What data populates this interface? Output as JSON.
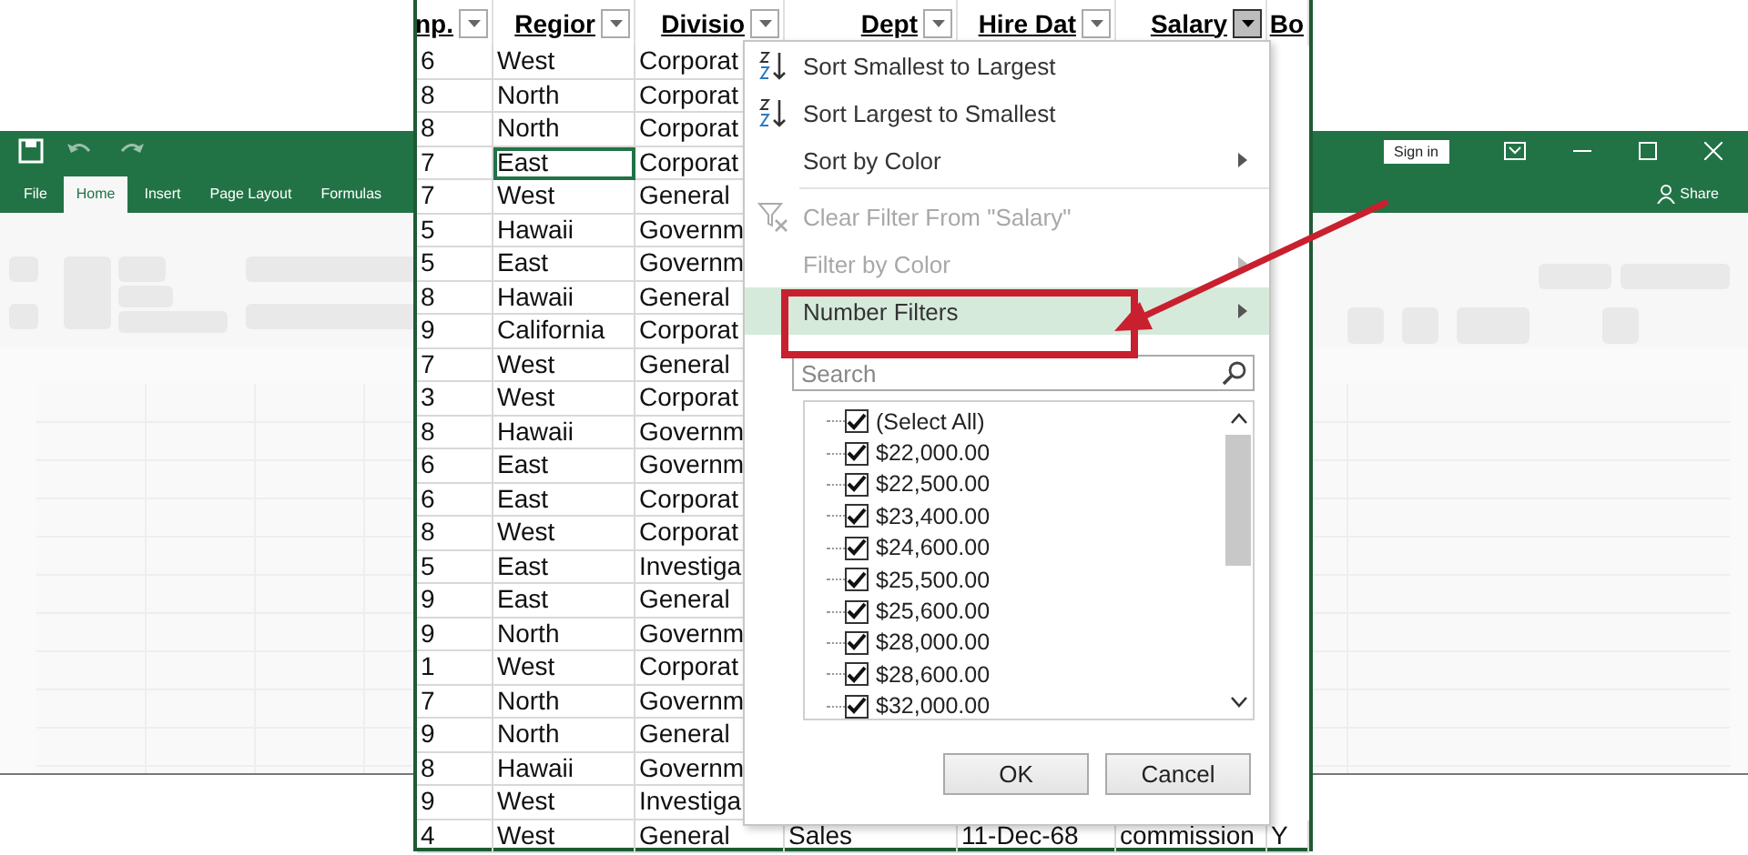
{
  "excel_window": {
    "tabs": [
      {
        "label": "File",
        "selected": false
      },
      {
        "label": "Home",
        "selected": true
      },
      {
        "label": "Insert",
        "selected": false
      },
      {
        "label": "Page Layout",
        "selected": false
      },
      {
        "label": "Formulas",
        "selected": false
      }
    ],
    "sign_in": "Sign in",
    "share": "Share"
  },
  "sheet": {
    "columns": [
      {
        "label": "np.",
        "menu_open": false
      },
      {
        "label": "Regior",
        "menu_open": false
      },
      {
        "label": "Divisio",
        "menu_open": false
      },
      {
        "label": "Dept",
        "menu_open": false
      },
      {
        "label": "Hire Dat",
        "menu_open": false
      },
      {
        "label": "Salary",
        "menu_open": true
      },
      {
        "label": "Bo"
      }
    ],
    "rows": [
      {
        "cells": [
          {
            "text": "6",
            "selected": false
          },
          {
            "text": "West",
            "selected": false
          },
          {
            "text": "Corporat",
            "selected": false
          }
        ]
      },
      {
        "cells": [
          {
            "text": "8",
            "selected": false
          },
          {
            "text": "North",
            "selected": false
          },
          {
            "text": "Corporat",
            "selected": false
          }
        ]
      },
      {
        "cells": [
          {
            "text": "8",
            "selected": false
          },
          {
            "text": "North",
            "selected": false
          },
          {
            "text": "Corporat",
            "selected": false
          }
        ]
      },
      {
        "cells": [
          {
            "text": "7",
            "selected": false
          },
          {
            "text": "East",
            "selected": true
          },
          {
            "text": "Corporat",
            "selected": false
          }
        ]
      },
      {
        "cells": [
          {
            "text": "7",
            "selected": false
          },
          {
            "text": "West",
            "selected": false
          },
          {
            "text": "General",
            "selected": false
          }
        ]
      },
      {
        "cells": [
          {
            "text": "5",
            "selected": false
          },
          {
            "text": "Hawaii",
            "selected": false
          },
          {
            "text": "Governm",
            "selected": false
          }
        ]
      },
      {
        "cells": [
          {
            "text": "5",
            "selected": false
          },
          {
            "text": "East",
            "selected": false
          },
          {
            "text": "Governm",
            "selected": false
          }
        ]
      },
      {
        "cells": [
          {
            "text": "8",
            "selected": false
          },
          {
            "text": "Hawaii",
            "selected": false
          },
          {
            "text": "General",
            "selected": false
          }
        ]
      },
      {
        "cells": [
          {
            "text": "9",
            "selected": false
          },
          {
            "text": "California",
            "selected": false
          },
          {
            "text": "Corporat",
            "selected": false
          }
        ]
      },
      {
        "cells": [
          {
            "text": "7",
            "selected": false
          },
          {
            "text": "West",
            "selected": false
          },
          {
            "text": "General",
            "selected": false
          }
        ]
      },
      {
        "cells": [
          {
            "text": "3",
            "selected": false
          },
          {
            "text": "West",
            "selected": false
          },
          {
            "text": "Corporat",
            "selected": false
          }
        ]
      },
      {
        "cells": [
          {
            "text": "8",
            "selected": false
          },
          {
            "text": "Hawaii",
            "selected": false
          },
          {
            "text": "Governm",
            "selected": false
          }
        ]
      },
      {
        "cells": [
          {
            "text": "6",
            "selected": false
          },
          {
            "text": "East",
            "selected": false
          },
          {
            "text": "Governm",
            "selected": false
          }
        ]
      },
      {
        "cells": [
          {
            "text": "6",
            "selected": false
          },
          {
            "text": "East",
            "selected": false
          },
          {
            "text": "Corporat",
            "selected": false
          }
        ]
      },
      {
        "cells": [
          {
            "text": "8",
            "selected": false
          },
          {
            "text": "West",
            "selected": false
          },
          {
            "text": "Corporat",
            "selected": false
          }
        ]
      },
      {
        "cells": [
          {
            "text": "5",
            "selected": false
          },
          {
            "text": "East",
            "selected": false
          },
          {
            "text": "Investiga",
            "selected": false
          }
        ]
      },
      {
        "cells": [
          {
            "text": "9",
            "selected": false
          },
          {
            "text": "East",
            "selected": false
          },
          {
            "text": "General",
            "selected": false
          }
        ]
      },
      {
        "cells": [
          {
            "text": "9",
            "selected": false
          },
          {
            "text": "North",
            "selected": false
          },
          {
            "text": "Governm",
            "selected": false
          }
        ]
      },
      {
        "cells": [
          {
            "text": "1",
            "selected": false
          },
          {
            "text": "West",
            "selected": false
          },
          {
            "text": "Corporat",
            "selected": false
          }
        ]
      },
      {
        "cells": [
          {
            "text": "7",
            "selected": false
          },
          {
            "text": "North",
            "selected": false
          },
          {
            "text": "Governm",
            "selected": false
          }
        ]
      },
      {
        "cells": [
          {
            "text": "9",
            "selected": false
          },
          {
            "text": "North",
            "selected": false
          },
          {
            "text": "General",
            "selected": false
          }
        ]
      },
      {
        "cells": [
          {
            "text": "8",
            "selected": false
          },
          {
            "text": "Hawaii",
            "selected": false
          },
          {
            "text": "Governm",
            "selected": false
          }
        ]
      },
      {
        "cells": [
          {
            "text": "9",
            "selected": false
          },
          {
            "text": "West",
            "selected": false
          },
          {
            "text": "Investiga",
            "selected": false
          }
        ]
      },
      {
        "cells": [
          {
            "text": "4",
            "selected": false
          },
          {
            "text": "West",
            "selected": false
          },
          {
            "text": "General",
            "selected": false
          },
          {
            "text": "Sales",
            "selected": false
          },
          {
            "text": "11-Dec-68",
            "selected": false
          },
          {
            "text": "commission",
            "selected": false
          },
          {
            "text": "Y",
            "selected": false
          }
        ]
      }
    ]
  },
  "filter_menu": {
    "items": [
      {
        "label": "Sort Smallest to Largest",
        "kind": "sort-asc",
        "disabled": false,
        "submenu": false,
        "highlighted": false
      },
      {
        "label": "Sort Largest to Smallest",
        "kind": "sort-desc",
        "disabled": false,
        "submenu": false,
        "highlighted": false
      },
      {
        "label": "Sort by Color",
        "kind": "plain",
        "disabled": false,
        "submenu": true,
        "highlighted": false
      },
      {
        "label": "Clear Filter From \"Salary\"",
        "kind": "clear-filter",
        "disabled": true,
        "submenu": false,
        "highlighted": false
      },
      {
        "label": "Filter by Color",
        "kind": "plain",
        "disabled": true,
        "submenu": true,
        "highlighted": false
      },
      {
        "label": "Number Filters",
        "kind": "plain",
        "disabled": false,
        "submenu": true,
        "highlighted": true
      }
    ],
    "search": {
      "placeholder": "Search"
    },
    "values": [
      {
        "label": "(Select All)",
        "checked": true
      },
      {
        "label": "$22,000.00",
        "checked": true
      },
      {
        "label": "$22,500.00",
        "checked": true
      },
      {
        "label": "$23,400.00",
        "checked": true
      },
      {
        "label": "$24,600.00",
        "checked": true
      },
      {
        "label": "$25,500.00",
        "checked": true
      },
      {
        "label": "$25,600.00",
        "checked": true
      },
      {
        "label": "$28,000.00",
        "checked": true
      },
      {
        "label": "$28,600.00",
        "checked": true
      },
      {
        "label": "$32,000.00",
        "checked": true
      }
    ],
    "buttons": [
      "OK",
      "Cancel"
    ]
  }
}
